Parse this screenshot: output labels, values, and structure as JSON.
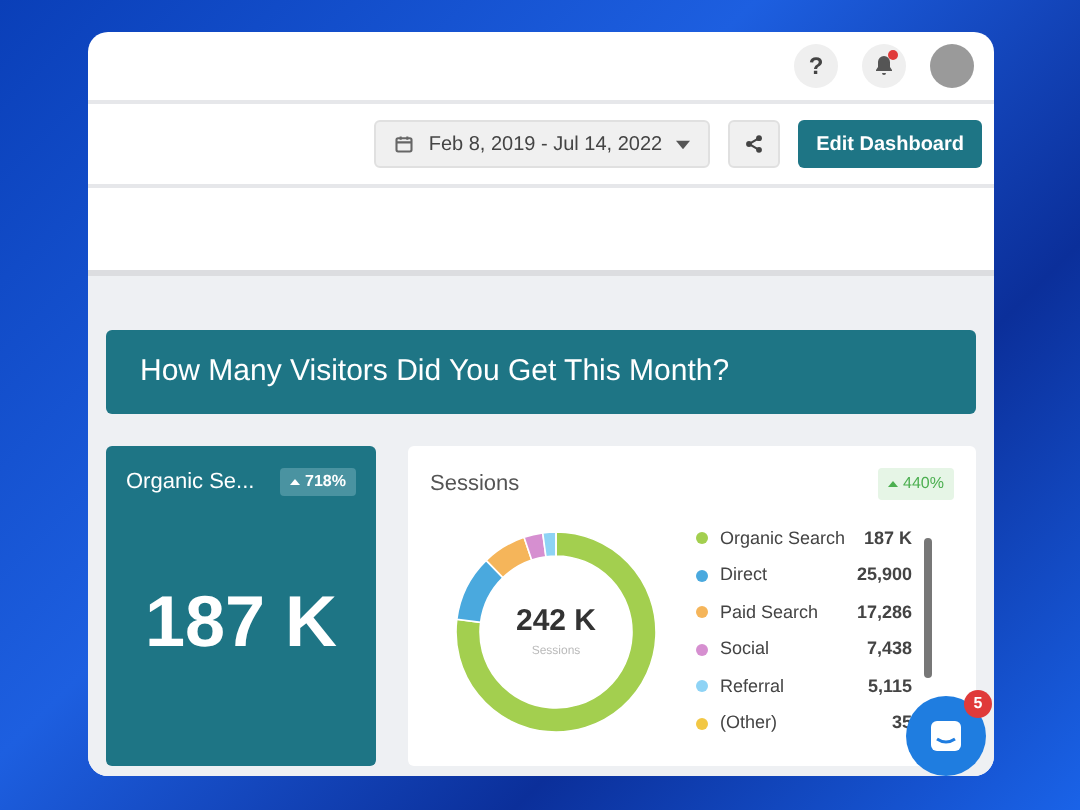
{
  "header": {
    "help_label": "?",
    "bell_unread": true
  },
  "toolbar": {
    "date_range": "Feb 8, 2019 - Jul 14, 2022",
    "edit_button": "Edit Dashboard"
  },
  "banner": {
    "title": "How Many Visitors Did You Get This Month?"
  },
  "kpi_card": {
    "title": "Organic Se...",
    "change": "718%",
    "value": "187 K"
  },
  "sessions_card": {
    "title": "Sessions",
    "change": "440%",
    "total": "242 K",
    "total_label": "Sessions",
    "legend": [
      {
        "value": "187 K",
        "color": "#a3cf4f"
      },
      {
        "value": "25,900",
        "color": "#4aa9de"
      },
      {
        "value": "17,286",
        "color": "#f5b55a"
      },
      {
        "value": "7,438",
        "color": "#d68fd0"
      },
      {
        "value": "5,115",
        "color": "#8ed3f5"
      },
      {
        "value": "35",
        "color": "#f2c744"
      }
    ],
    "chart_data": {
      "type": "donut",
      "categories": [
        "Organic Search",
        "Direct",
        "Paid Search",
        "Social",
        "Referral",
        "(Other)"
      ],
      "values": [
        77.03,
        10.67,
        7.12,
        3.06,
        2.11,
        0.01
      ]
    }
  },
  "chat": {
    "badge": "5"
  }
}
